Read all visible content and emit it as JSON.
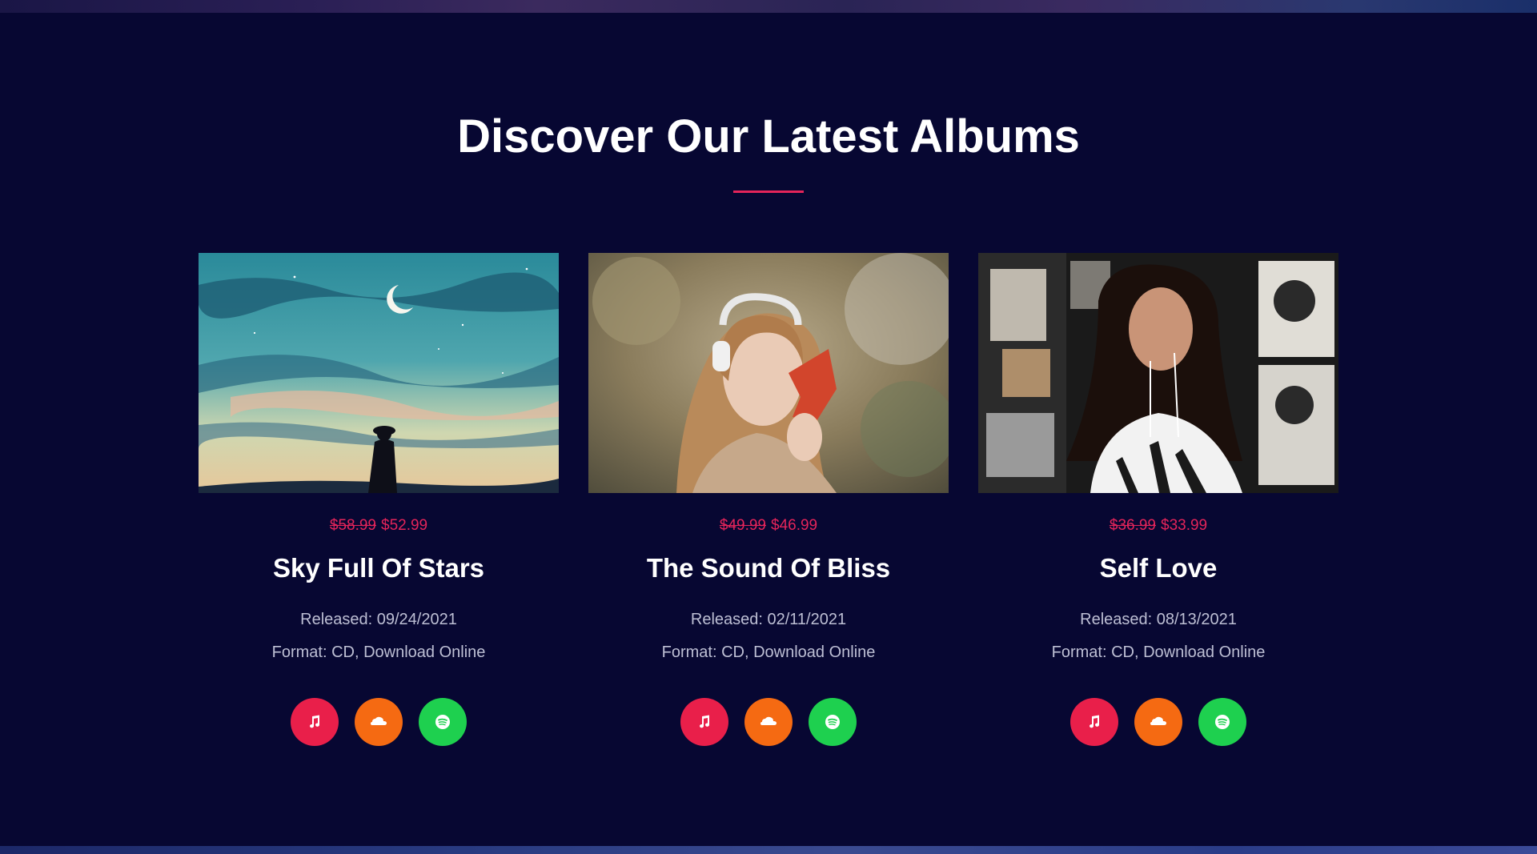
{
  "section": {
    "title": "Discover Our Latest Albums"
  },
  "albums": [
    {
      "old_price": "$58.99",
      "price": "$52.99",
      "title": "Sky Full Of Stars",
      "released": "Released: 09/24/2021",
      "format": "Format: CD, Download Online",
      "cover": "night-sky-silhouette"
    },
    {
      "old_price": "$49.99",
      "price": "$46.99",
      "title": "The Sound Of Bliss",
      "released": "Released: 02/11/2021",
      "format": "Format: CD, Download Online",
      "cover": "woman-headphones-autumn-leaf"
    },
    {
      "old_price": "$36.99",
      "price": "$33.99",
      "title": "Self Love",
      "released": "Released: 08/13/2021",
      "format": "Format: CD, Download Online",
      "cover": "woman-earphones-poster-wall"
    }
  ],
  "listen_links": [
    {
      "icon": "music-note-icon",
      "color": "#e91f4a"
    },
    {
      "icon": "soundcloud-icon",
      "color": "#f56a12"
    },
    {
      "icon": "spotify-icon",
      "color": "#1ed04f"
    }
  ],
  "colors": {
    "background": "#070732",
    "accent": "#e4245a"
  }
}
